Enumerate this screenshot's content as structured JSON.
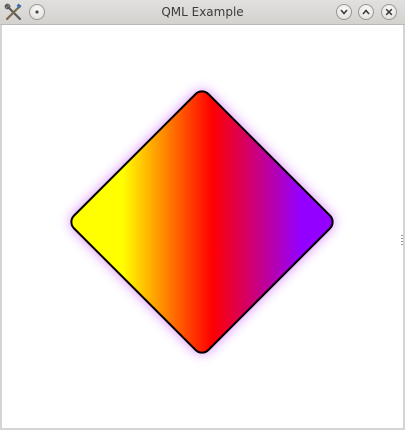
{
  "window": {
    "title": "QML Example"
  },
  "titlebar": {
    "app_icon": "wrench-screwdriver-icon",
    "pin_icon": "pin-dot-icon",
    "minimize_icon": "chevron-down-icon",
    "maximize_icon": "chevron-up-icon",
    "close_icon": "close-icon"
  },
  "shape": {
    "type": "rotated-rounded-rectangle",
    "gradient_stops": [
      "#9400ff",
      "#ff0000",
      "#ffff00"
    ],
    "border_color": "#000000",
    "glow_color": "#cc66ff"
  }
}
